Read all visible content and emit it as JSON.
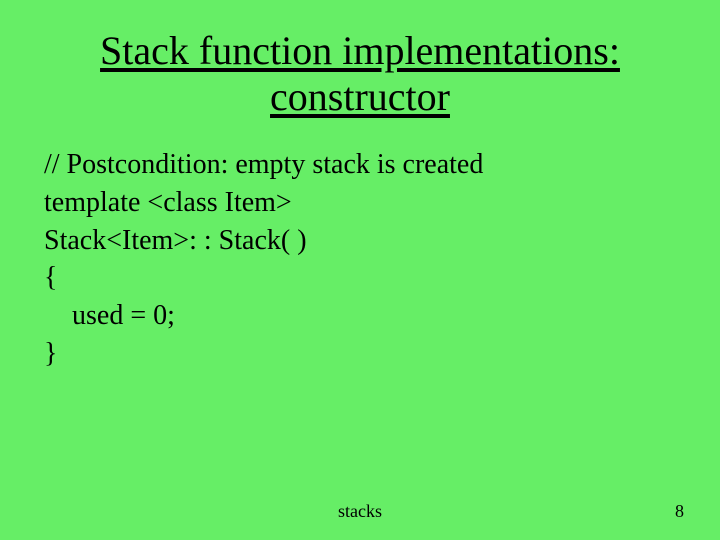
{
  "title_line1": "Stack function implementations:",
  "title_line2": "constructor",
  "body": {
    "line1": "// Postcondition: empty stack is created",
    "line2": "template <class Item>",
    "line3": "Stack<Item>: : Stack( )",
    "line4": "{",
    "line5": "used = 0;",
    "line6": "}"
  },
  "footer": {
    "label": "stacks",
    "page": "8"
  }
}
